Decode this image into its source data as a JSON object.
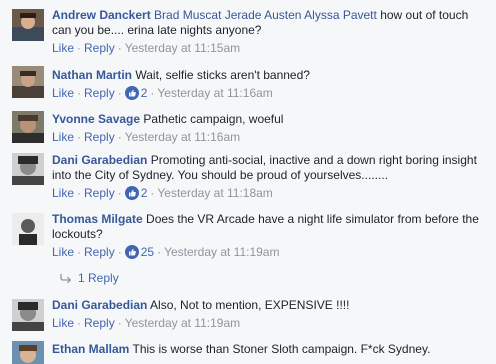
{
  "comments": [
    {
      "author": "Andrew Danckert",
      "mentions": [
        "Brad Muscat",
        "Jerade Austen",
        "Alyssa Pavett"
      ],
      "text_after": "how out of touch can you be.... erina late nights anyone?",
      "like_label": "Like",
      "reply_label": "Reply",
      "timestamp": "Yesterday at 11:15am"
    },
    {
      "author": "Nathan Martin",
      "text": "Wait, selfie sticks aren't banned?",
      "like_label": "Like",
      "reply_label": "Reply",
      "likes": "2",
      "timestamp": "Yesterday at 11:16am"
    },
    {
      "author": "Yvonne Savage",
      "text": "Pathetic campaign, woeful",
      "like_label": "Like",
      "reply_label": "Reply",
      "timestamp": "Yesterday at 11:16am"
    },
    {
      "author": "Dani Garabedian",
      "text": "Promoting anti-social, inactive and a down right boring insight into the City of Sydney. You should be proud of yourselves........",
      "like_label": "Like",
      "reply_label": "Reply",
      "likes": "2",
      "timestamp": "Yesterday at 11:18am"
    },
    {
      "author": "Thomas Milgate",
      "text": "Does the VR Arcade have a night life simulator from before the lockouts?",
      "like_label": "Like",
      "reply_label": "Reply",
      "likes": "25",
      "timestamp": "Yesterday at 11:19am"
    },
    {
      "author": "Dani Garabedian",
      "text": "Also, Not to mention, EXPENSIVE !!!!",
      "like_label": "Like",
      "reply_label": "Reply",
      "timestamp": "Yesterday at 11:19am"
    },
    {
      "author": "Ethan Mallam",
      "text": "This is worse than Stoner Sloth campaign. F*ck Sydney."
    }
  ],
  "replies_link": "1 Reply",
  "separator": "·",
  "colors": {
    "link": "#365899",
    "action": "#4267b2",
    "meta": "#90949c",
    "background": "#f6f7f9",
    "like_badge": "#4267b2"
  }
}
